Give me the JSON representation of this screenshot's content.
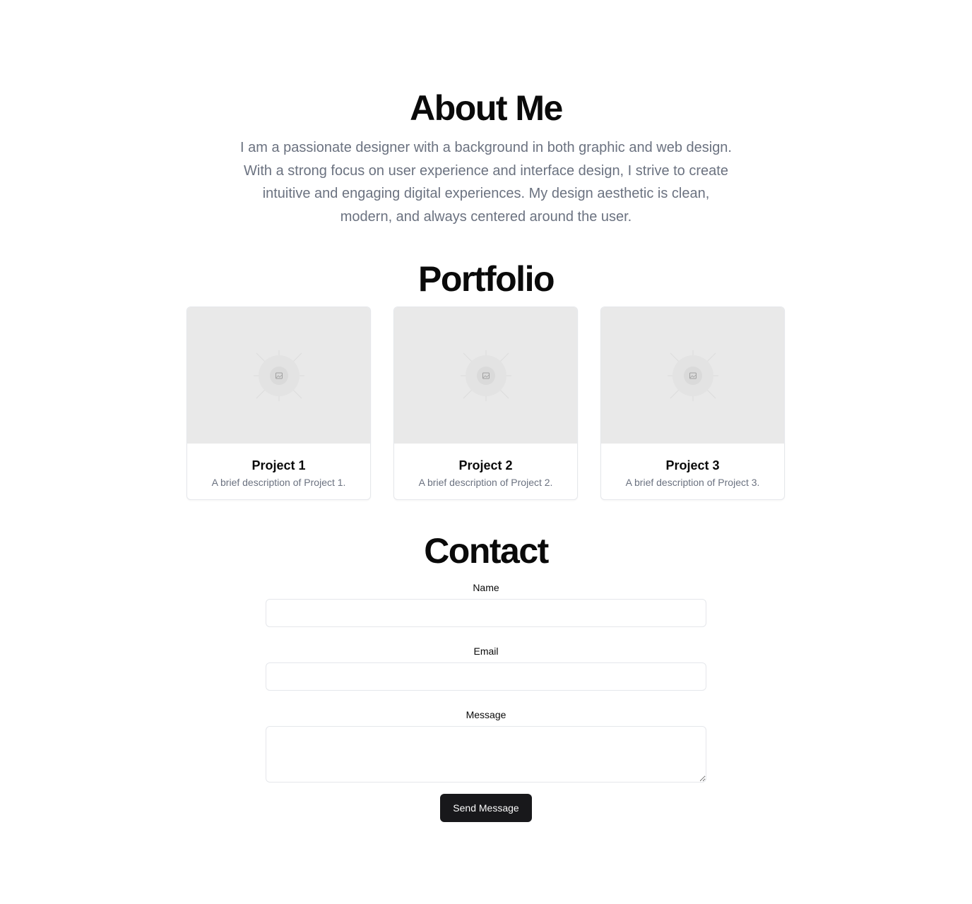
{
  "about": {
    "title": "About Me",
    "text": "I am a passionate designer with a background in both graphic and web design. With a strong focus on user experience and interface design, I strive to create intuitive and engaging digital experiences. My design aesthetic is clean, modern, and always centered around the user."
  },
  "portfolio": {
    "title": "Portfolio",
    "projects": [
      {
        "title": "Project 1",
        "description": "A brief description of Project 1.",
        "image_icon": "image-placeholder-icon"
      },
      {
        "title": "Project 2",
        "description": "A brief description of Project 2.",
        "image_icon": "image-placeholder-icon"
      },
      {
        "title": "Project 3",
        "description": "A brief description of Project 3.",
        "image_icon": "image-placeholder-icon"
      }
    ]
  },
  "contact": {
    "title": "Contact",
    "name_label": "Name",
    "name_value": "",
    "email_label": "Email",
    "email_value": "",
    "message_label": "Message",
    "message_value": "",
    "submit_label": "Send Message"
  },
  "colors": {
    "heading": "#0a0a0a",
    "muted_text": "#6b7280",
    "placeholder_bg": "#e9e9e9",
    "border": "#e5e7eb",
    "button_bg": "#18181b",
    "button_text": "#fafafa"
  }
}
